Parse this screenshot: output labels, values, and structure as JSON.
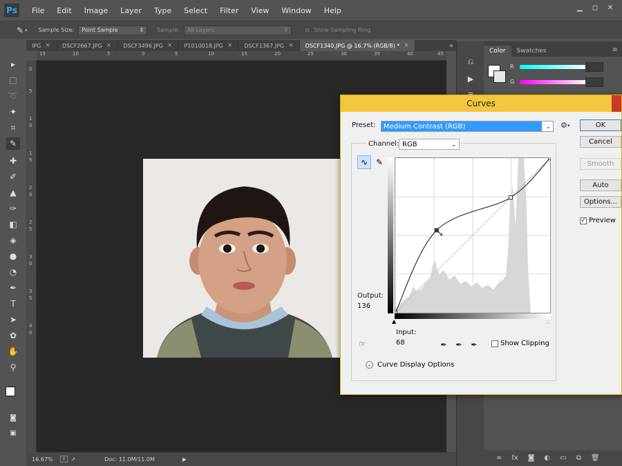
{
  "app": {
    "logo": "Ps",
    "menu": [
      "File",
      "Edit",
      "Image",
      "Layer",
      "Type",
      "Select",
      "Filter",
      "View",
      "Window",
      "Help"
    ]
  },
  "options_bar": {
    "sample_size_label": "Sample Size:",
    "sample_size_value": "Point Sample",
    "sample_label": "Sample:",
    "sample_value": "All Layers",
    "show_ring_label": "Show Sampling Ring"
  },
  "tabs": [
    {
      "label": "IPG",
      "active": false
    },
    {
      "label": "DSCF2667.JPG",
      "active": false
    },
    {
      "label": "DSCF3496.JPG",
      "active": false
    },
    {
      "label": "P1010018.JPG",
      "active": false
    },
    {
      "label": "DSCF1367.JPG",
      "active": false
    },
    {
      "label": "DSCF1340.JPG @ 16.7% (RGB/8) *",
      "active": true
    }
  ],
  "ruler_h": [
    "15",
    "10",
    "5",
    "0",
    "5",
    "10",
    "15",
    "20",
    "25",
    "30",
    "35",
    "40",
    "45"
  ],
  "ruler_v": [
    "0",
    "5",
    "1",
    "0",
    "1",
    "5",
    "2",
    "0",
    "2",
    "5",
    "3",
    "0",
    "3",
    "5",
    "4",
    "0"
  ],
  "status": {
    "zoom": "16.67%",
    "doc": "Doc: 11.0M/11.0M"
  },
  "right_panel": {
    "tab_color": "Color",
    "tab_swatches": "Swatches",
    "r_label": "R",
    "g_label": "G"
  },
  "curves": {
    "title": "Curves",
    "preset_label": "Preset:",
    "preset_value": "Medium Contrast (RGB)",
    "channel_label": "Channel:",
    "channel_value": "RGB",
    "output_label": "Output:",
    "output_value": "136",
    "input_label": "Input:",
    "input_value": "68",
    "show_clipping": "Show Clipping",
    "display_options": "Curve Display Options",
    "buttons": {
      "ok": "OK",
      "cancel": "Cancel",
      "smooth": "Smooth",
      "auto": "Auto",
      "options": "Options..."
    },
    "preview_label": "Preview",
    "preview_checked": true,
    "curve_points": [
      [
        0,
        0
      ],
      [
        68,
        136
      ],
      [
        190,
        190
      ],
      [
        255,
        255
      ]
    ]
  }
}
